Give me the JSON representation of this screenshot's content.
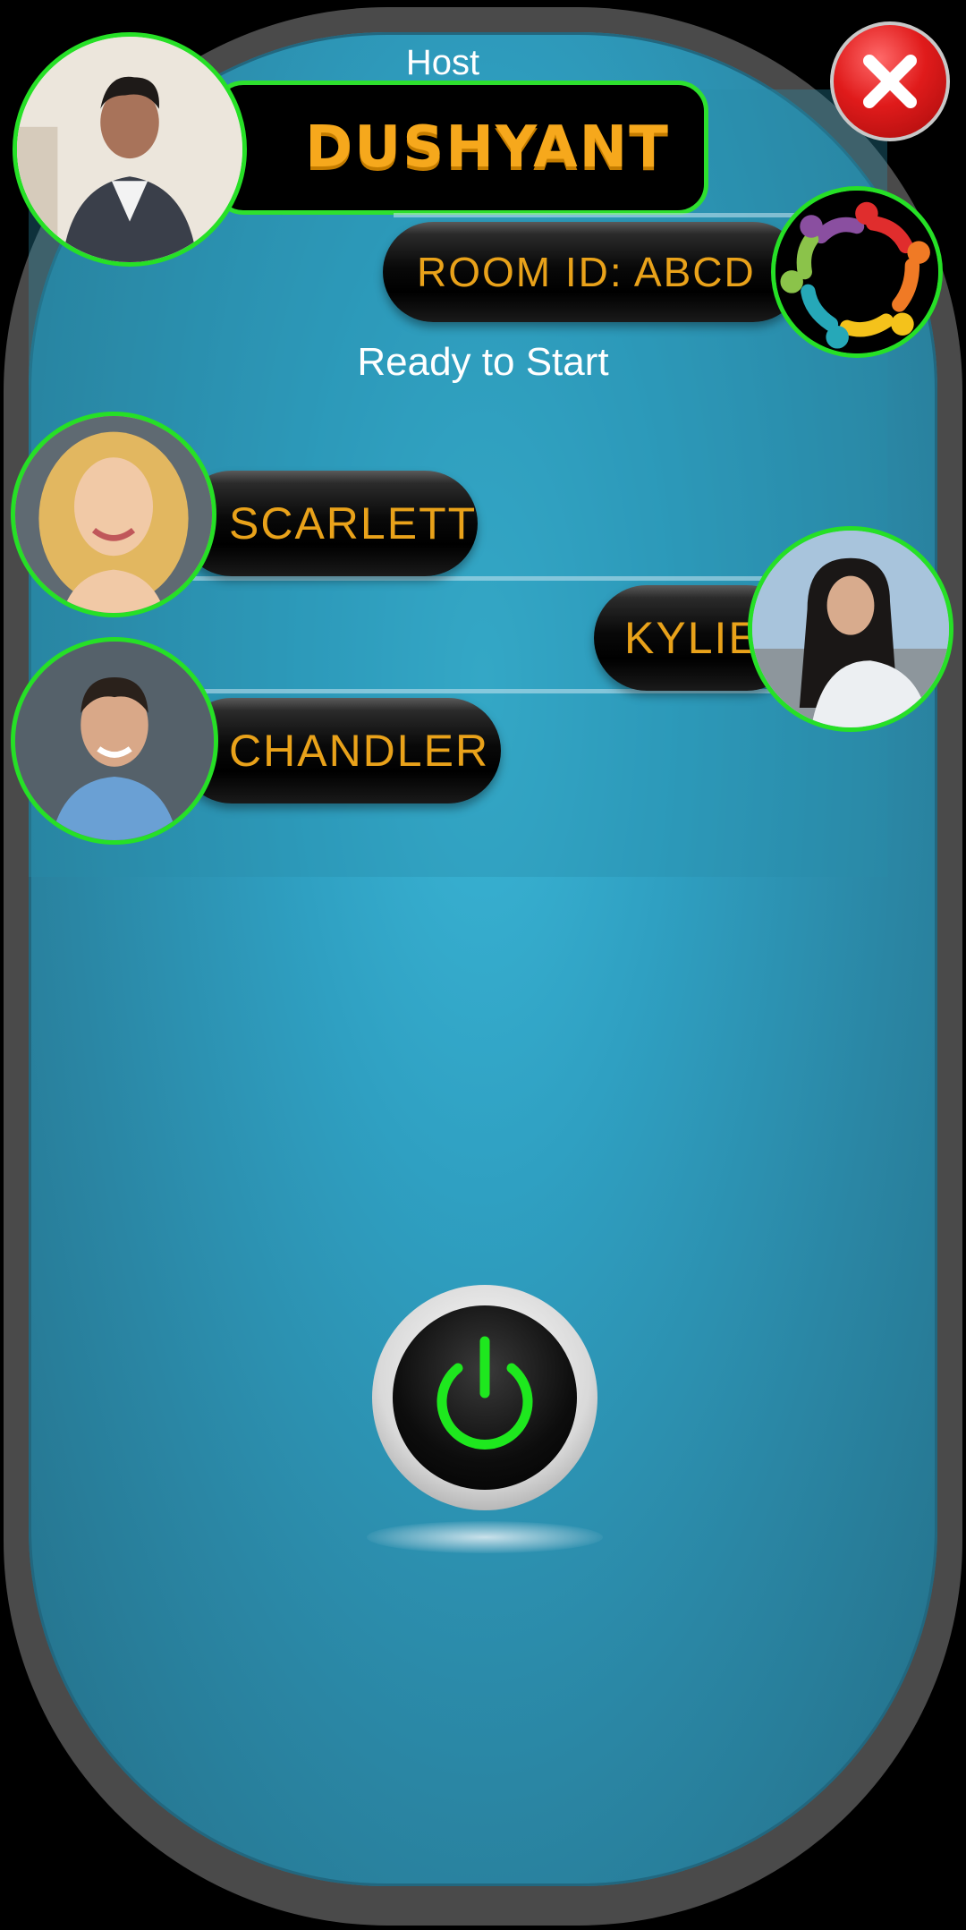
{
  "host": {
    "label": "Host",
    "name": "DUSHYANT"
  },
  "room": {
    "id_text": "ROOM ID: ABCD"
  },
  "status": {
    "text": "Ready to Start"
  },
  "players": [
    {
      "name": "SCARLETT"
    },
    {
      "name": "KYLIE"
    },
    {
      "name": "CHANDLER"
    }
  ],
  "icons": {
    "close": "close-icon",
    "power": "power-icon",
    "group": "group-icon"
  },
  "colors": {
    "accent_green": "#26e026",
    "name_orange": "#e9a21a",
    "table_blue": "#2fa0c2"
  }
}
